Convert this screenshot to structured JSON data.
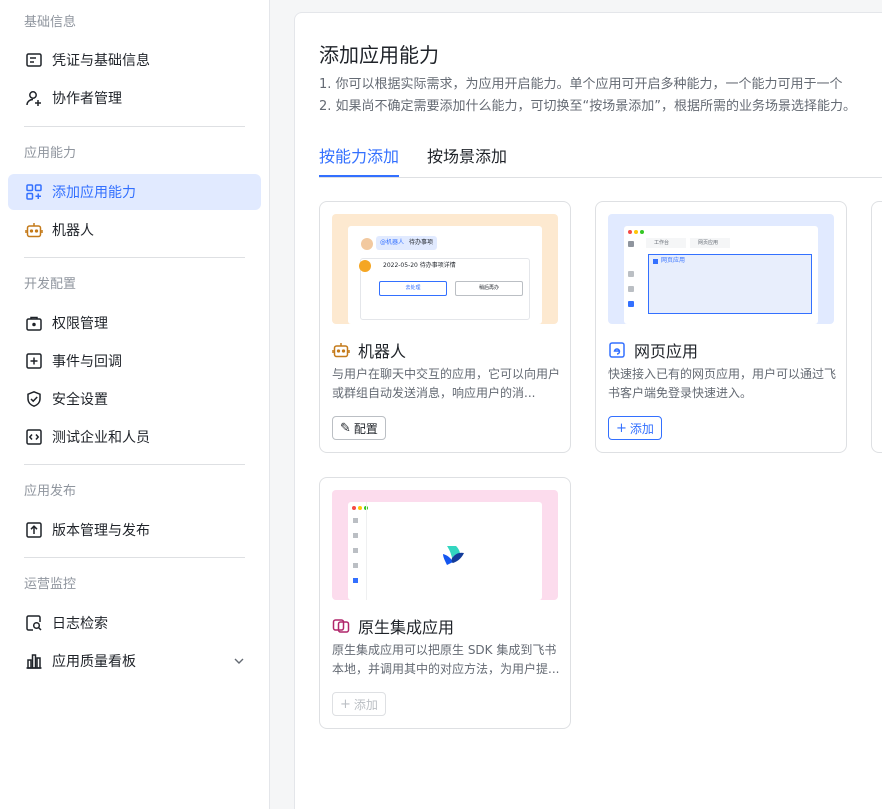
{
  "sidebar": {
    "groups": [
      {
        "title": "基础信息",
        "items": [
          {
            "label": "凭证与基础信息",
            "icon": "credential-icon"
          },
          {
            "label": "协作者管理",
            "icon": "add-user-icon"
          }
        ]
      },
      {
        "title": "应用能力",
        "items": [
          {
            "label": "添加应用能力",
            "icon": "grid-add-icon",
            "active": true
          },
          {
            "label": "机器人",
            "icon": "robot-icon"
          }
        ]
      },
      {
        "title": "开发配置",
        "items": [
          {
            "label": "权限管理",
            "icon": "lock-box-icon"
          },
          {
            "label": "事件与回调",
            "icon": "event-icon"
          },
          {
            "label": "安全设置",
            "icon": "shield-icon"
          },
          {
            "label": "测试企业和人员",
            "icon": "code-icon"
          }
        ]
      },
      {
        "title": "应用发布",
        "items": [
          {
            "label": "版本管理与发布",
            "icon": "upload-icon"
          }
        ]
      },
      {
        "title": "运营监控",
        "items": [
          {
            "label": "日志检索",
            "icon": "log-search-icon"
          },
          {
            "label": "应用质量看板",
            "icon": "bar-chart-icon"
          }
        ]
      }
    ]
  },
  "main": {
    "title": "添加应用能力",
    "desc1": "1. 你可以根据实际需求，为应用开启能力。单个应用可开启多种能力，一个能力可用于一个",
    "desc2": "2. 如果尚不确定需要添加什么能力，可切换至“按场景添加”，根据所需的业务场景选择能力。",
    "tabs": [
      {
        "label": "按能力添加",
        "active": true
      },
      {
        "label": "按场景添加",
        "active": false
      }
    ],
    "cards": [
      {
        "title": "机器人",
        "desc": "与用户在聊天中交互的应用，它可以向用户或群组自动发送消息，响应用户的消...",
        "button": "配置",
        "button_icon": "✎",
        "preview": {
          "bot_tag": "@机器人",
          "todo": "待办事项",
          "date_line": "2022-05-20 待办事项详情",
          "btn1": "去处理",
          "btn2": "稍后再办"
        }
      },
      {
        "title": "网页应用",
        "desc": "快速接入已有的网页应用，用户可以通过飞书客户端免登录快速进入。",
        "button": "添加",
        "button_icon": "+",
        "preview": {
          "tab1": "工作台",
          "tab2": "网页应用",
          "window_label": "网页应用"
        }
      },
      {
        "title": "原生集成应用",
        "desc": "原生集成应用可以把原生 SDK 集成到飞书本地，并调用其中的对应方法，为用户提...",
        "button": "添加",
        "button_icon": "+"
      }
    ]
  },
  "colors": {
    "accent": "#3370ff",
    "active_bg": "#e1eaff",
    "robot": "#c47a1a",
    "native": "#b0266b"
  }
}
